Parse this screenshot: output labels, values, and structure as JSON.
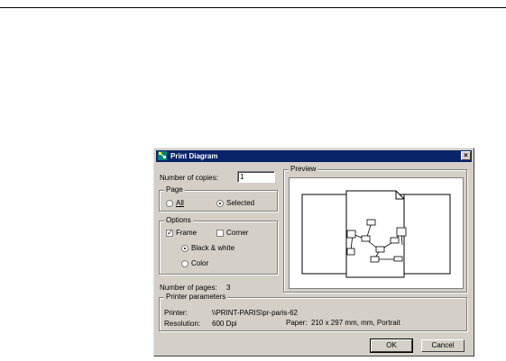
{
  "dialog": {
    "title": "Print Diagram",
    "close_glyph": "×",
    "copies_label": "Number of copies:",
    "copies_value": "1",
    "page": {
      "legend": "Page",
      "all_label": "All",
      "selected_label": "Selected",
      "selected": "Selected"
    },
    "options": {
      "legend": "Options",
      "frame_label": "Frame",
      "frame_checked": true,
      "corner_label": "Corner",
      "corner_checked": false,
      "bw_label": "Black & white",
      "color_label": "Color",
      "selected_mode": "Black & white"
    },
    "num_pages_label": "Number of pages:",
    "num_pages_value": "3",
    "preview_legend": "Preview",
    "printer_params": {
      "legend": "Printer parameters",
      "printer_label": "Printer:",
      "printer_value": "\\\\PRINT-PARIS\\pr-paris-62",
      "resolution_label": "Resolution:",
      "resolution_value": "600 Dpi",
      "paper_label": "Paper:",
      "paper_value": "210 x 297 mm, mm, Portrait"
    },
    "ok_label": "OK",
    "cancel_label": "Cancel"
  },
  "icons": {
    "app_icon": "diagram-icon",
    "close_icon": "close-icon",
    "check_mark": "✓"
  },
  "colors": {
    "titlebar": "#0a246a",
    "dialog_face": "#d4d0c8"
  }
}
